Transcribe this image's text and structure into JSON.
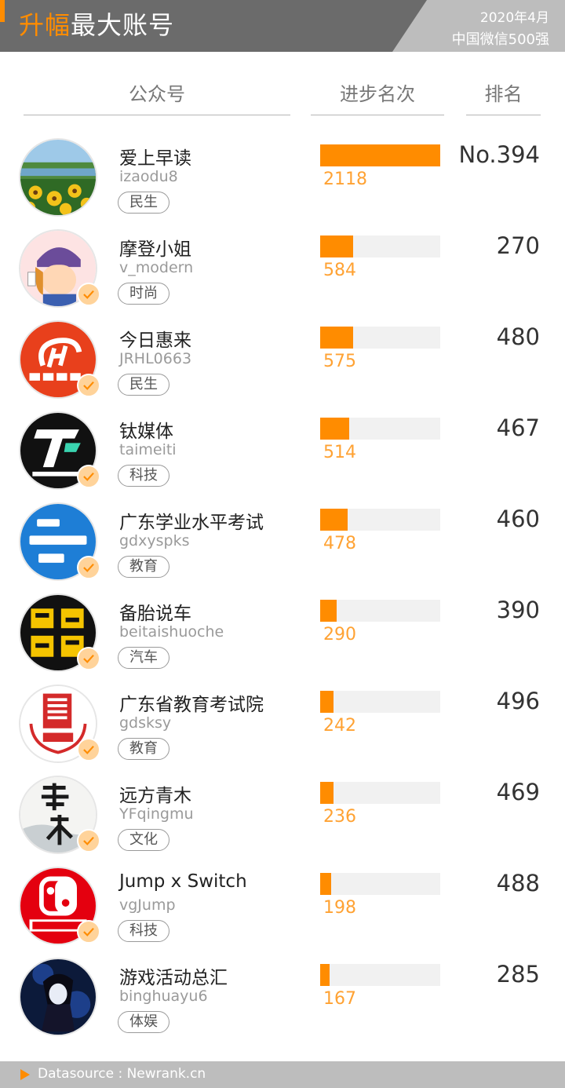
{
  "header": {
    "title_highlight": "升幅",
    "title_rest": "最大账号",
    "date": "2020年4月",
    "subtitle": "中国微信500强",
    "colors": {
      "accent": "#ff8c00",
      "header_bg": "#6b6b6b",
      "meta_bg": "#bdbdbd"
    }
  },
  "columns": {
    "account": "公众号",
    "progress": "进步名次",
    "rank": "排名"
  },
  "rows": [
    {
      "name": "爱上早读",
      "handle": "izaodu8",
      "tag": "民生",
      "progress": 2118,
      "rank": "No.394",
      "verified": false,
      "avatar": "sunflower-landscape-avatar"
    },
    {
      "name": "摩登小姐",
      "handle": "v_modern",
      "tag": "时尚",
      "progress": 584,
      "rank": "270",
      "verified": true,
      "avatar": "cartoon-woman-wine-avatar"
    },
    {
      "name": "今日惠来",
      "handle": "JRHL0663",
      "tag": "民生",
      "progress": 575,
      "rank": "480",
      "verified": true,
      "avatar": "jrhl-logo-avatar"
    },
    {
      "name": "钛媒体",
      "handle": "taimeiti",
      "tag": "科技",
      "progress": 514,
      "rank": "467",
      "verified": true,
      "avatar": "tmtpost-logo-avatar"
    },
    {
      "name": "广东学业水平考试",
      "handle": "gdxyspks",
      "tag": "教育",
      "progress": 478,
      "rank": "460",
      "verified": true,
      "avatar": "gd-exam-logo-avatar"
    },
    {
      "name": "备胎说车",
      "handle": "beitaishuoche",
      "tag": "汽车",
      "progress": 290,
      "rank": "390",
      "verified": true,
      "avatar": "beitai-logo-avatar"
    },
    {
      "name": "广东省教育考试院",
      "handle": "gdsksy",
      "tag": "教育",
      "progress": 242,
      "rank": "496",
      "verified": true,
      "avatar": "exam-institute-seal-avatar"
    },
    {
      "name": "远方青木",
      "handle": "YFqingmu",
      "tag": "文化",
      "progress": 236,
      "rank": "469",
      "verified": true,
      "avatar": "calligraphy-avatar"
    },
    {
      "name": "Jump x Switch",
      "handle": "vgJump",
      "tag": "科技",
      "progress": 198,
      "rank": "488",
      "verified": true,
      "avatar": "switch-jump-logo-avatar"
    },
    {
      "name": "游戏活动总汇",
      "handle": "binghuayu6",
      "tag": "体娱",
      "progress": 167,
      "rank": "285",
      "verified": false,
      "avatar": "anime-character-avatar"
    }
  ],
  "progress_max": 2118,
  "footer": {
    "source": "Datasource : Newrank.cn"
  }
}
